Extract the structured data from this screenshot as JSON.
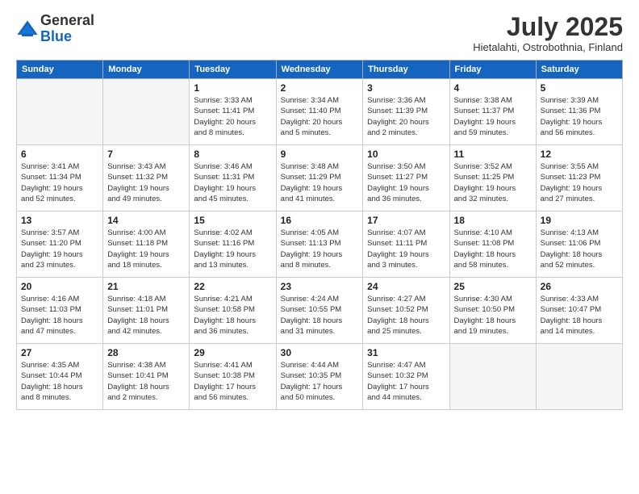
{
  "logo": {
    "general": "General",
    "blue": "Blue"
  },
  "title": "July 2025",
  "subtitle": "Hietalahti, Ostrobothnia, Finland",
  "headers": [
    "Sunday",
    "Monday",
    "Tuesday",
    "Wednesday",
    "Thursday",
    "Friday",
    "Saturday"
  ],
  "weeks": [
    [
      {
        "day": "",
        "info": ""
      },
      {
        "day": "",
        "info": ""
      },
      {
        "day": "1",
        "info": "Sunrise: 3:33 AM\nSunset: 11:41 PM\nDaylight: 20 hours\nand 8 minutes."
      },
      {
        "day": "2",
        "info": "Sunrise: 3:34 AM\nSunset: 11:40 PM\nDaylight: 20 hours\nand 5 minutes."
      },
      {
        "day": "3",
        "info": "Sunrise: 3:36 AM\nSunset: 11:39 PM\nDaylight: 20 hours\nand 2 minutes."
      },
      {
        "day": "4",
        "info": "Sunrise: 3:38 AM\nSunset: 11:37 PM\nDaylight: 19 hours\nand 59 minutes."
      },
      {
        "day": "5",
        "info": "Sunrise: 3:39 AM\nSunset: 11:36 PM\nDaylight: 19 hours\nand 56 minutes."
      }
    ],
    [
      {
        "day": "6",
        "info": "Sunrise: 3:41 AM\nSunset: 11:34 PM\nDaylight: 19 hours\nand 52 minutes."
      },
      {
        "day": "7",
        "info": "Sunrise: 3:43 AM\nSunset: 11:32 PM\nDaylight: 19 hours\nand 49 minutes."
      },
      {
        "day": "8",
        "info": "Sunrise: 3:46 AM\nSunset: 11:31 PM\nDaylight: 19 hours\nand 45 minutes."
      },
      {
        "day": "9",
        "info": "Sunrise: 3:48 AM\nSunset: 11:29 PM\nDaylight: 19 hours\nand 41 minutes."
      },
      {
        "day": "10",
        "info": "Sunrise: 3:50 AM\nSunset: 11:27 PM\nDaylight: 19 hours\nand 36 minutes."
      },
      {
        "day": "11",
        "info": "Sunrise: 3:52 AM\nSunset: 11:25 PM\nDaylight: 19 hours\nand 32 minutes."
      },
      {
        "day": "12",
        "info": "Sunrise: 3:55 AM\nSunset: 11:23 PM\nDaylight: 19 hours\nand 27 minutes."
      }
    ],
    [
      {
        "day": "13",
        "info": "Sunrise: 3:57 AM\nSunset: 11:20 PM\nDaylight: 19 hours\nand 23 minutes."
      },
      {
        "day": "14",
        "info": "Sunrise: 4:00 AM\nSunset: 11:18 PM\nDaylight: 19 hours\nand 18 minutes."
      },
      {
        "day": "15",
        "info": "Sunrise: 4:02 AM\nSunset: 11:16 PM\nDaylight: 19 hours\nand 13 minutes."
      },
      {
        "day": "16",
        "info": "Sunrise: 4:05 AM\nSunset: 11:13 PM\nDaylight: 19 hours\nand 8 minutes."
      },
      {
        "day": "17",
        "info": "Sunrise: 4:07 AM\nSunset: 11:11 PM\nDaylight: 19 hours\nand 3 minutes."
      },
      {
        "day": "18",
        "info": "Sunrise: 4:10 AM\nSunset: 11:08 PM\nDaylight: 18 hours\nand 58 minutes."
      },
      {
        "day": "19",
        "info": "Sunrise: 4:13 AM\nSunset: 11:06 PM\nDaylight: 18 hours\nand 52 minutes."
      }
    ],
    [
      {
        "day": "20",
        "info": "Sunrise: 4:16 AM\nSunset: 11:03 PM\nDaylight: 18 hours\nand 47 minutes."
      },
      {
        "day": "21",
        "info": "Sunrise: 4:18 AM\nSunset: 11:01 PM\nDaylight: 18 hours\nand 42 minutes."
      },
      {
        "day": "22",
        "info": "Sunrise: 4:21 AM\nSunset: 10:58 PM\nDaylight: 18 hours\nand 36 minutes."
      },
      {
        "day": "23",
        "info": "Sunrise: 4:24 AM\nSunset: 10:55 PM\nDaylight: 18 hours\nand 31 minutes."
      },
      {
        "day": "24",
        "info": "Sunrise: 4:27 AM\nSunset: 10:52 PM\nDaylight: 18 hours\nand 25 minutes."
      },
      {
        "day": "25",
        "info": "Sunrise: 4:30 AM\nSunset: 10:50 PM\nDaylight: 18 hours\nand 19 minutes."
      },
      {
        "day": "26",
        "info": "Sunrise: 4:33 AM\nSunset: 10:47 PM\nDaylight: 18 hours\nand 14 minutes."
      }
    ],
    [
      {
        "day": "27",
        "info": "Sunrise: 4:35 AM\nSunset: 10:44 PM\nDaylight: 18 hours\nand 8 minutes."
      },
      {
        "day": "28",
        "info": "Sunrise: 4:38 AM\nSunset: 10:41 PM\nDaylight: 18 hours\nand 2 minutes."
      },
      {
        "day": "29",
        "info": "Sunrise: 4:41 AM\nSunset: 10:38 PM\nDaylight: 17 hours\nand 56 minutes."
      },
      {
        "day": "30",
        "info": "Sunrise: 4:44 AM\nSunset: 10:35 PM\nDaylight: 17 hours\nand 50 minutes."
      },
      {
        "day": "31",
        "info": "Sunrise: 4:47 AM\nSunset: 10:32 PM\nDaylight: 17 hours\nand 44 minutes."
      },
      {
        "day": "",
        "info": ""
      },
      {
        "day": "",
        "info": ""
      }
    ]
  ]
}
